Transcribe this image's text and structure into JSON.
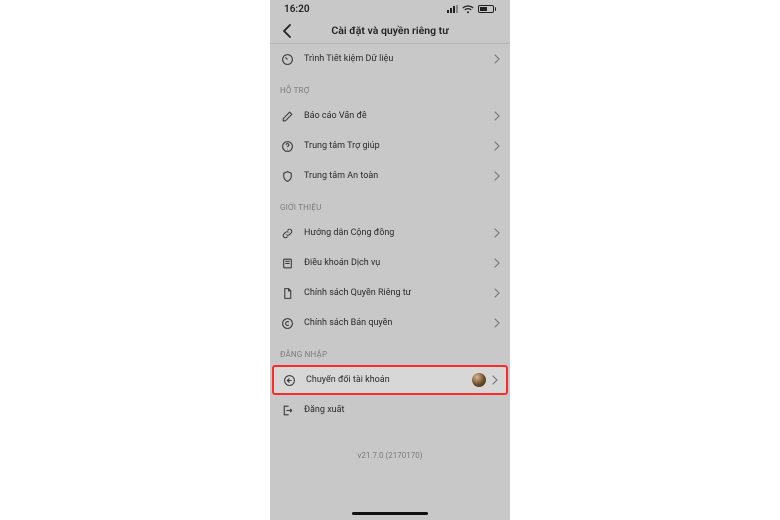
{
  "statusbar": {
    "time": "16:20"
  },
  "nav": {
    "title": "Cài đặt và quyền riêng tư"
  },
  "section_general": {
    "data_saver": "Trình Tiết kiệm Dữ liệu"
  },
  "section_support": {
    "header": "HỖ TRỢ",
    "report_problem": "Báo cáo Vấn đề",
    "help_center": "Trung tâm Trợ giúp",
    "safety_center": "Trung tâm An toàn"
  },
  "section_about": {
    "header": "GIỚI THIỆU",
    "community_guidelines": "Hướng dẫn Cộng đồng",
    "terms": "Điều khoản Dịch vụ",
    "privacy_policy": "Chính sách Quyền Riêng tư",
    "copyright_policy": "Chính sách Bản quyền"
  },
  "section_login": {
    "header": "ĐĂNG NHẬP",
    "switch_account": "Chuyển đổi tài khoản",
    "logout": "Đăng xuất"
  },
  "version": "v21.7.0 (2170170)"
}
